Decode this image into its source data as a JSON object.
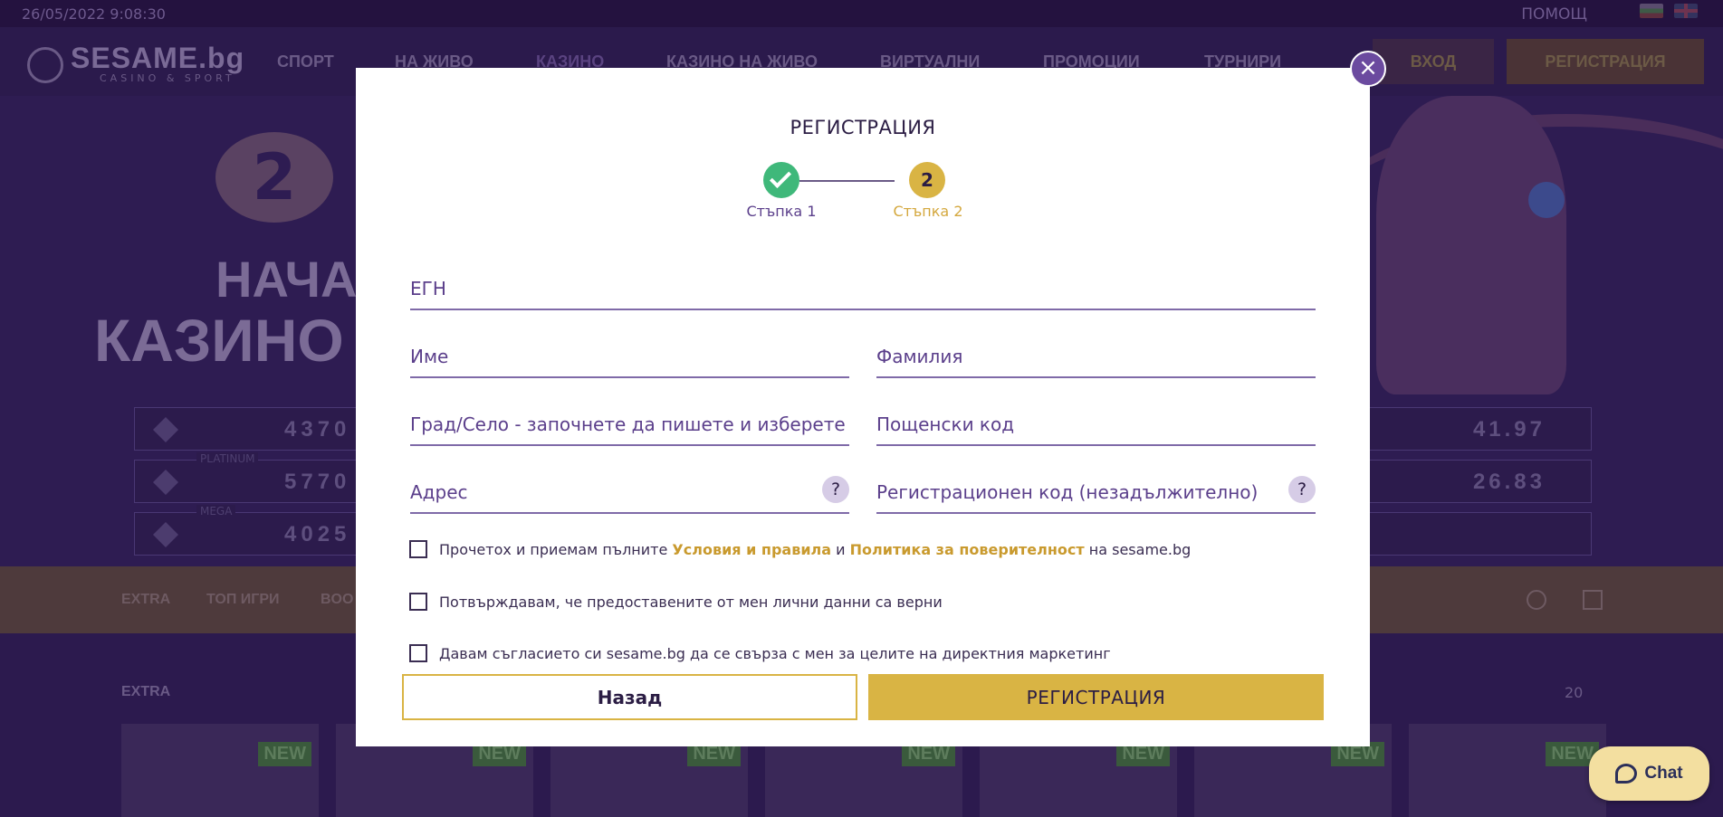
{
  "topbar": {
    "datetime": "26/05/2022 9:08:30",
    "help": "ПОМОЩ"
  },
  "nav": {
    "logo_text": "SESAME.bg",
    "logo_sub": "CASINO & SPORT",
    "items": [
      "СПОРТ",
      "НА ЖИВО",
      "КАЗИНО",
      "КАЗИНО НА ЖИВО",
      "ВИРТУАЛНИ",
      "ПРОМОЦИИ",
      "ТУРНИРИ"
    ],
    "login": "ВХОД",
    "register": "РЕГИСТРАЦИЯ"
  },
  "hero": {
    "chip": "2",
    "line1": "НАЧА",
    "line2": "КАЗИНО"
  },
  "jackpots": [
    {
      "tag": "",
      "value": "4370",
      "right_value": "41.97"
    },
    {
      "tag": "PLATINUM",
      "value": "5770",
      "right_value": "26.83"
    },
    {
      "tag": "MEGA",
      "value": "4025",
      "right_value": ""
    }
  ],
  "categories": [
    "EXTRA",
    "ТОП ИГРИ",
    "BOO"
  ],
  "games": {
    "section_label": "EXTRA",
    "count": "20",
    "new_badge": "NEW"
  },
  "modal": {
    "title": "РЕГИСТРАЦИЯ",
    "steps": [
      {
        "label": "Стъпка 1",
        "status": "done"
      },
      {
        "label": "Стъпка 2",
        "number": "2",
        "status": "active"
      }
    ],
    "fields": {
      "egn": "ЕГН",
      "first_name": "Име",
      "last_name": "Фамилия",
      "city": "Град/Село - започнете да пишете и изберете",
      "postal_code": "Пощенски код",
      "address": "Адрес",
      "reg_code": "Регистрационен код (незадължително)",
      "help": "?"
    },
    "checkboxes": {
      "terms_prefix": "Прочетох и приемам пълните ",
      "terms_link": "Условия и правила",
      "terms_and": " и ",
      "privacy_link": "Политика за поверителност",
      "terms_suffix": " на sesame.bg",
      "data_confirm": "Потвърждавам, че предоставените от мен лични данни са верни",
      "marketing": "Давам съгласието си sesame.bg да се свърза с мен за целите на директния маркетинг"
    },
    "back_button": "Назад",
    "register_button": "РЕГИСТРАЦИЯ",
    "close": "×"
  },
  "chat": {
    "label": "Chat"
  },
  "colors": {
    "purple": "#5b3f8b",
    "gold": "#d9b444",
    "green": "#3fb87a"
  }
}
